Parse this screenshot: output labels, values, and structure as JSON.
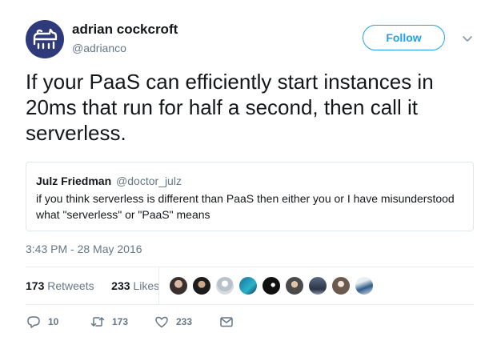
{
  "user": {
    "name": "adrian cockcroft",
    "handle": "@adrianco",
    "follow_label": "Follow"
  },
  "tweet": {
    "text": "If your PaaS can efficiently start instances in 20ms that run for half a second, then call it serverless."
  },
  "quoted": {
    "name": "Julz Friedman",
    "handle": "@doctor_julz",
    "text": "if you think serverless is different than PaaS then either you or I have misunderstood what \"serverless\" or \"PaaS\" means"
  },
  "timestamp": "3:43 PM - 28 May 2016",
  "stats": {
    "retweets_count": "173",
    "retweets_label": "Retweets",
    "likes_count": "233",
    "likes_label": "Likes"
  },
  "actions": {
    "reply_count": "10",
    "retweet_count": "173",
    "like_count": "233"
  },
  "colors": {
    "accent": "#1da1f2",
    "secondary_text": "#657786",
    "border": "#e1e8ed",
    "avatar_bg": "#2e3a7a"
  }
}
